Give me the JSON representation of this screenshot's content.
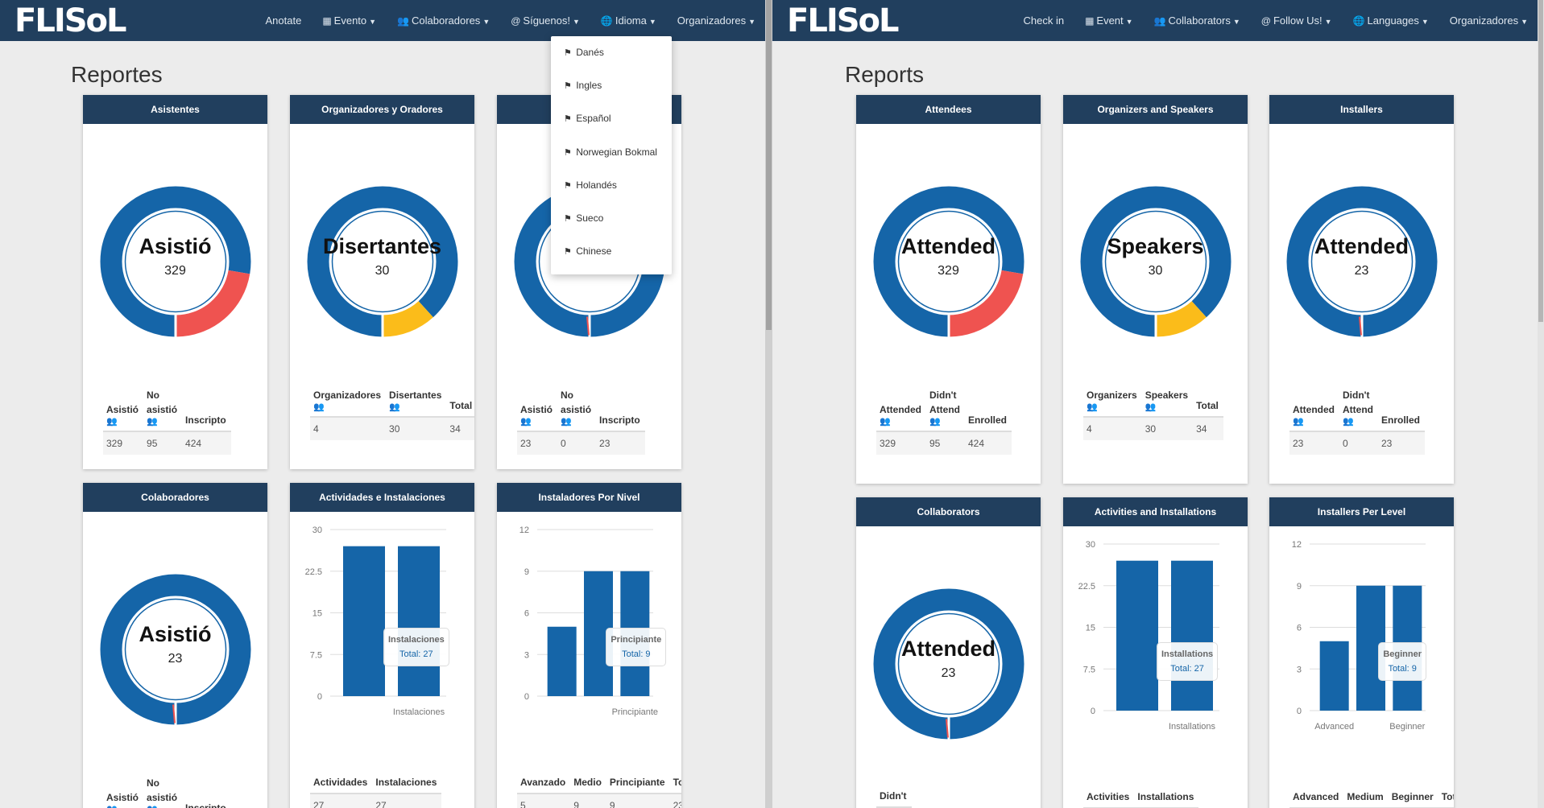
{
  "left": {
    "brand": "FLISoL",
    "nav": [
      {
        "icon": "",
        "label": "Anotate"
      },
      {
        "icon": "▦",
        "label": "Evento"
      },
      {
        "icon": "👥",
        "label": "Colaboradores"
      },
      {
        "icon": "@",
        "label": "Síguenos!"
      },
      {
        "icon": "🌐",
        "label": "Idioma"
      },
      {
        "icon": "",
        "label": "Organizadores"
      }
    ],
    "title": "Reportes",
    "language_menu": [
      "Danés",
      "Ingles",
      "Español",
      "Norwegian Bokmal",
      "Holandés",
      "Sueco",
      "Chinese"
    ],
    "donut_panels": [
      {
        "header": "Asistentes",
        "center_label": "Asistió",
        "center_value": "329",
        "segments": [
          {
            "value": 329,
            "color": "#1565a8"
          },
          {
            "value": 95,
            "color": "#ef5350"
          }
        ],
        "cols": [
          {
            "label_lines": [
              "Asistió"
            ],
            "icon": "blue"
          },
          {
            "label_lines": [
              "No",
              "asistió"
            ],
            "icon": "red"
          },
          {
            "label_lines": [
              "Inscripto"
            ],
            "icon": ""
          }
        ],
        "values": [
          "329",
          "95",
          "424"
        ]
      },
      {
        "header": "Organizadores y Oradores",
        "center_label": "Disertantes",
        "center_value": "30",
        "segments": [
          {
            "value": 30,
            "color": "#1565a8"
          },
          {
            "value": 4,
            "color": "#fbbc1a"
          }
        ],
        "cols": [
          {
            "label_lines": [
              "Organizadores"
            ],
            "icon": "blue"
          },
          {
            "label_lines": [
              "Disertantes"
            ],
            "icon": "red"
          },
          {
            "label_lines": [
              "Total"
            ],
            "icon": ""
          }
        ],
        "values": [
          "4",
          "30",
          "34"
        ]
      },
      {
        "header": "",
        "center_label": "",
        "center_value": "",
        "segments": [
          {
            "value": 23,
            "color": "#1565a8"
          },
          {
            "value": 0,
            "color": "#ef5350"
          }
        ],
        "cols": [
          {
            "label_lines": [
              "Asistió"
            ],
            "icon": "blue"
          },
          {
            "label_lines": [
              "No",
              "asistió"
            ],
            "icon": "red"
          },
          {
            "label_lines": [
              "Inscripto"
            ],
            "icon": ""
          }
        ],
        "values": [
          "23",
          "0",
          "23"
        ]
      },
      {
        "header": "Colaboradores",
        "center_label": "Asistió",
        "center_value": "23",
        "segments": [
          {
            "value": 23,
            "color": "#1565a8"
          },
          {
            "value": 0,
            "color": "#ef5350"
          }
        ],
        "cols": [
          {
            "label_lines": [
              "Asistió"
            ],
            "icon": "blue"
          },
          {
            "label_lines": [
              "No",
              "asistió"
            ],
            "icon": "red"
          },
          {
            "label_lines": [
              "Inscripto"
            ],
            "icon": ""
          }
        ],
        "values": []
      }
    ],
    "bar_panels": [
      {
        "header": "Actividades e Instalaciones",
        "yticks": [
          "30",
          "22.5",
          "15",
          "7.5",
          "0"
        ],
        "ymax": 30,
        "bars": [
          27,
          27
        ],
        "xlabels": [
          "",
          "Instalaciones"
        ],
        "tooltip_title": "Instalaciones",
        "tooltip_value": "Total: 27",
        "cols": [
          "Actividades",
          "Instalaciones"
        ],
        "values": [
          "27",
          "27"
        ]
      },
      {
        "header": "Instaladores Por Nivel",
        "yticks": [
          "12",
          "9",
          "6",
          "3",
          "0"
        ],
        "ymax": 12,
        "bars": [
          5,
          9,
          9
        ],
        "xlabels": [
          "",
          "",
          "Principiante"
        ],
        "tooltip_title": "Principiante",
        "tooltip_value": "Total: 9",
        "cols": [
          "Avanzado",
          "Medio",
          "Principiante",
          "Total"
        ],
        "values": [
          "5",
          "9",
          "9",
          "23"
        ]
      }
    ]
  },
  "right": {
    "brand": "FLISoL",
    "nav": [
      {
        "icon": "",
        "label": "Check in"
      },
      {
        "icon": "▦",
        "label": "Event"
      },
      {
        "icon": "👥",
        "label": "Collaborators"
      },
      {
        "icon": "@",
        "label": "Follow Us!"
      },
      {
        "icon": "🌐",
        "label": "Languages"
      },
      {
        "icon": "",
        "label": "Organizadores"
      }
    ],
    "title": "Reports",
    "donut_panels": [
      {
        "header": "Attendees",
        "center_label": "Attended",
        "center_value": "329",
        "segments": [
          {
            "value": 329,
            "color": "#1565a8"
          },
          {
            "value": 95,
            "color": "#ef5350"
          }
        ],
        "cols": [
          {
            "label_lines": [
              "Attended"
            ],
            "icon": "blue"
          },
          {
            "label_lines": [
              "Didn't",
              "Attend"
            ],
            "icon": "red"
          },
          {
            "label_lines": [
              "Enrolled"
            ],
            "icon": ""
          }
        ],
        "values": [
          "329",
          "95",
          "424"
        ]
      },
      {
        "header": "Organizers and Speakers",
        "center_label": "Speakers",
        "center_value": "30",
        "segments": [
          {
            "value": 30,
            "color": "#1565a8"
          },
          {
            "value": 4,
            "color": "#fbbc1a"
          }
        ],
        "cols": [
          {
            "label_lines": [
              "Organizers"
            ],
            "icon": "blue"
          },
          {
            "label_lines": [
              "Speakers"
            ],
            "icon": "red"
          },
          {
            "label_lines": [
              "Total"
            ],
            "icon": ""
          }
        ],
        "values": [
          "4",
          "30",
          "34"
        ]
      },
      {
        "header": "Installers",
        "center_label": "Attended",
        "center_value": "23",
        "segments": [
          {
            "value": 23,
            "color": "#1565a8"
          },
          {
            "value": 0,
            "color": "#ef5350"
          }
        ],
        "cols": [
          {
            "label_lines": [
              "Attended"
            ],
            "icon": "blue"
          },
          {
            "label_lines": [
              "Didn't",
              "Attend"
            ],
            "icon": "red"
          },
          {
            "label_lines": [
              "Enrolled"
            ],
            "icon": ""
          }
        ],
        "values": [
          "23",
          "0",
          "23"
        ]
      },
      {
        "header": "Collaborators",
        "center_label": "Attended",
        "center_value": "23",
        "segments": [
          {
            "value": 23,
            "color": "#1565a8"
          },
          {
            "value": 0,
            "color": "#ef5350"
          }
        ],
        "cols": [
          {
            "label_lines": [
              "Didn't"
            ],
            "icon": ""
          }
        ],
        "values": []
      }
    ],
    "bar_panels": [
      {
        "header": "Activities and Installations",
        "yticks": [
          "30",
          "22.5",
          "15",
          "7.5",
          "0"
        ],
        "ymax": 30,
        "bars": [
          27,
          27
        ],
        "xlabels": [
          "",
          "Installations"
        ],
        "tooltip_title": "Installations",
        "tooltip_value": "Total: 27",
        "cols": [
          "Activities",
          "Installations"
        ],
        "values": []
      },
      {
        "header": "Installers Per Level",
        "yticks": [
          "12",
          "9",
          "6",
          "3",
          "0"
        ],
        "ymax": 12,
        "bars": [
          5,
          9,
          9
        ],
        "xlabels": [
          "Advanced",
          "",
          "Beginner"
        ],
        "tooltip_title": "Beginner",
        "tooltip_value": "Total: 9",
        "cols": [
          "Advanced",
          "Medium",
          "Beginner",
          "Total"
        ],
        "values": []
      }
    ]
  },
  "chart_data": [
    {
      "type": "pie",
      "title": "Asistentes",
      "categories": [
        "Asistió",
        "No asistió"
      ],
      "values": [
        329,
        95
      ]
    },
    {
      "type": "pie",
      "title": "Organizadores y Oradores",
      "categories": [
        "Disertantes",
        "Organizadores"
      ],
      "values": [
        30,
        4
      ]
    },
    {
      "type": "pie",
      "title": "",
      "categories": [
        "Asistió",
        "No asistió"
      ],
      "values": [
        23,
        0
      ]
    },
    {
      "type": "pie",
      "title": "Colaboradores",
      "categories": [
        "Asistió",
        "No asistió"
      ],
      "values": [
        23,
        0
      ]
    },
    {
      "type": "bar",
      "title": "Actividades e Instalaciones",
      "categories": [
        "Actividades",
        "Instalaciones"
      ],
      "values": [
        27,
        27
      ],
      "ylim": [
        0,
        30
      ]
    },
    {
      "type": "bar",
      "title": "Instaladores Por Nivel",
      "categories": [
        "Avanzado",
        "Medio",
        "Principiante"
      ],
      "values": [
        5,
        9,
        9
      ],
      "ylim": [
        0,
        12
      ]
    },
    {
      "type": "pie",
      "title": "Attendees",
      "categories": [
        "Attended",
        "Didn't Attend"
      ],
      "values": [
        329,
        95
      ]
    },
    {
      "type": "pie",
      "title": "Organizers and Speakers",
      "categories": [
        "Speakers",
        "Organizers"
      ],
      "values": [
        30,
        4
      ]
    },
    {
      "type": "pie",
      "title": "Installers",
      "categories": [
        "Attended",
        "Didn't Attend"
      ],
      "values": [
        23,
        0
      ]
    },
    {
      "type": "pie",
      "title": "Collaborators",
      "categories": [
        "Attended",
        "Didn't Attend"
      ],
      "values": [
        23,
        0
      ]
    },
    {
      "type": "bar",
      "title": "Activities and Installations",
      "categories": [
        "Activities",
        "Installations"
      ],
      "values": [
        27,
        27
      ],
      "ylim": [
        0,
        30
      ]
    },
    {
      "type": "bar",
      "title": "Installers Per Level",
      "categories": [
        "Advanced",
        "Medium",
        "Beginner"
      ],
      "values": [
        5,
        9,
        9
      ],
      "ylim": [
        0,
        12
      ]
    }
  ]
}
